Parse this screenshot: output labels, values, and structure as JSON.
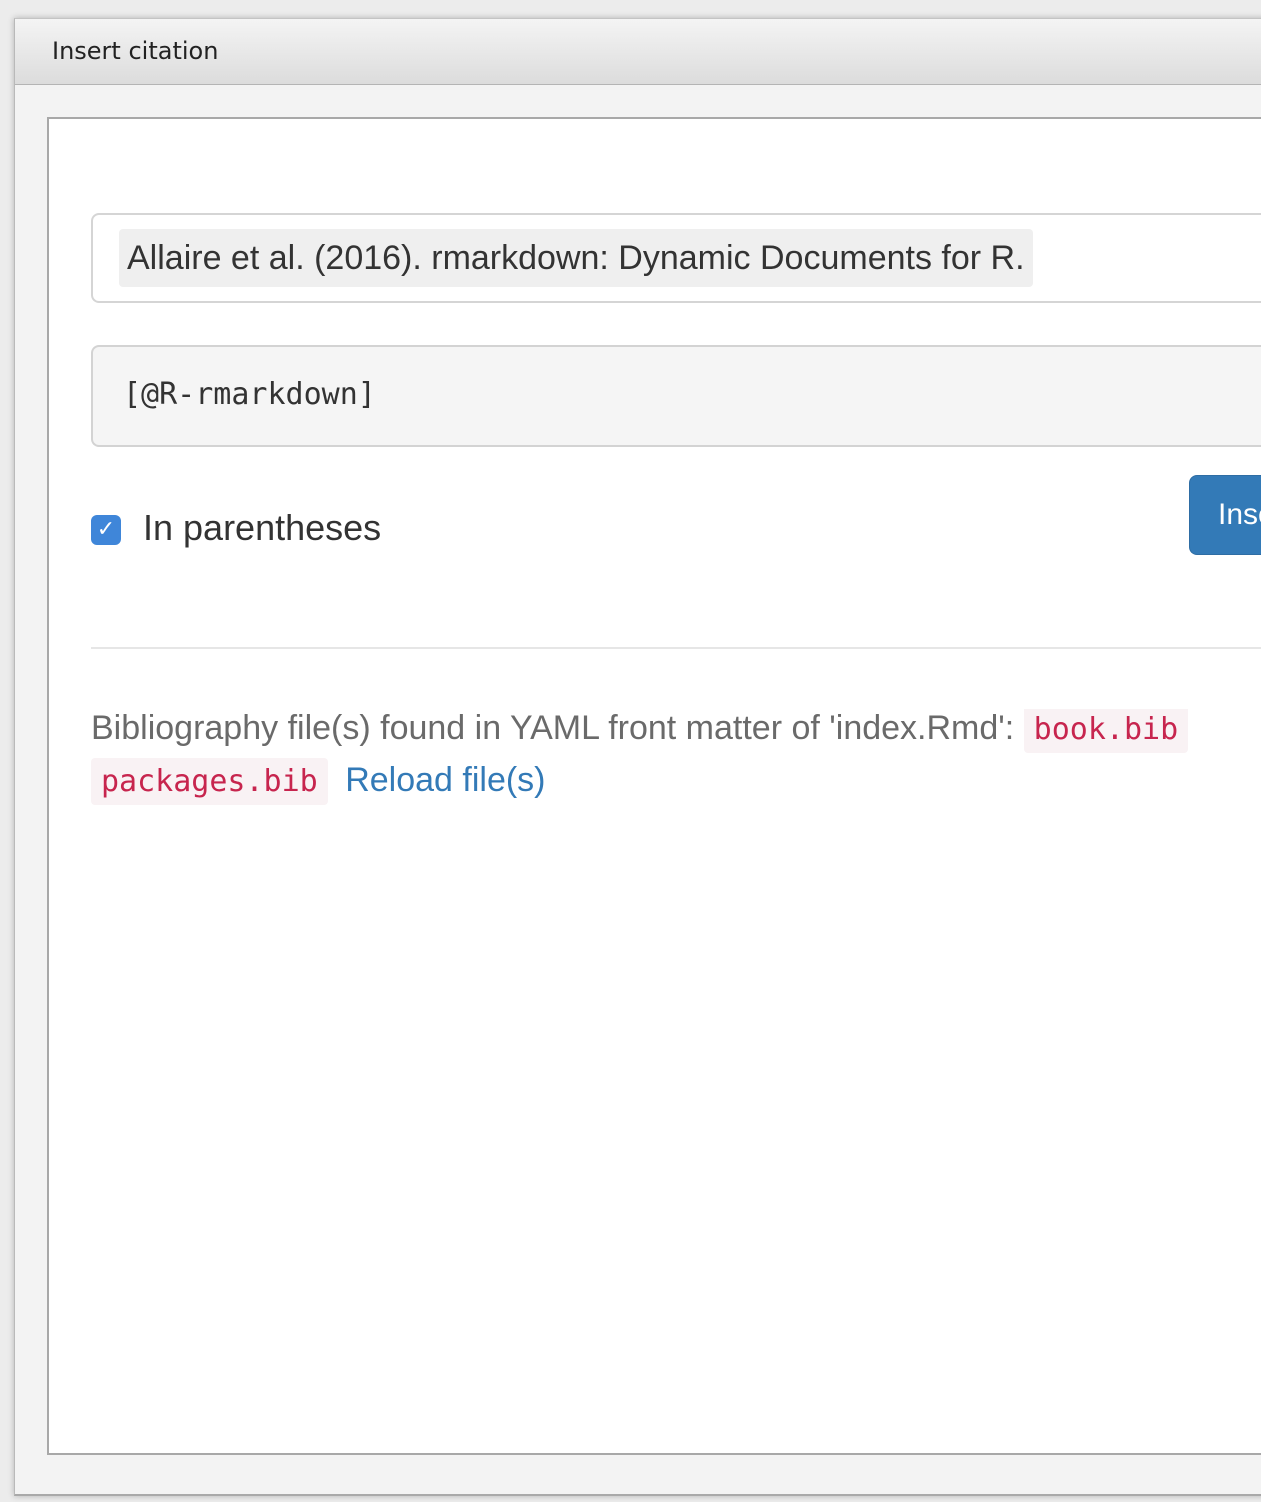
{
  "window": {
    "title": "Insert citation"
  },
  "citation": {
    "selected": "Allaire et al. (2016). rmarkdown: Dynamic Documents for R.",
    "key": "[@R-rmarkdown]"
  },
  "options": {
    "in_parentheses_label": "In parentheses",
    "in_parentheses_checked": true,
    "insert_label": "Insert"
  },
  "bibliography": {
    "message": "Bibliography file(s) found in YAML front matter of 'index.Rmd':",
    "files": [
      "book.bib",
      "packages.bib"
    ],
    "reload_label": "Reload file(s)"
  },
  "colors": {
    "accent": "#337ab7",
    "checkbox": "#3f86d9",
    "code_text": "#c7254e",
    "code_bg": "#f9f2f4"
  }
}
